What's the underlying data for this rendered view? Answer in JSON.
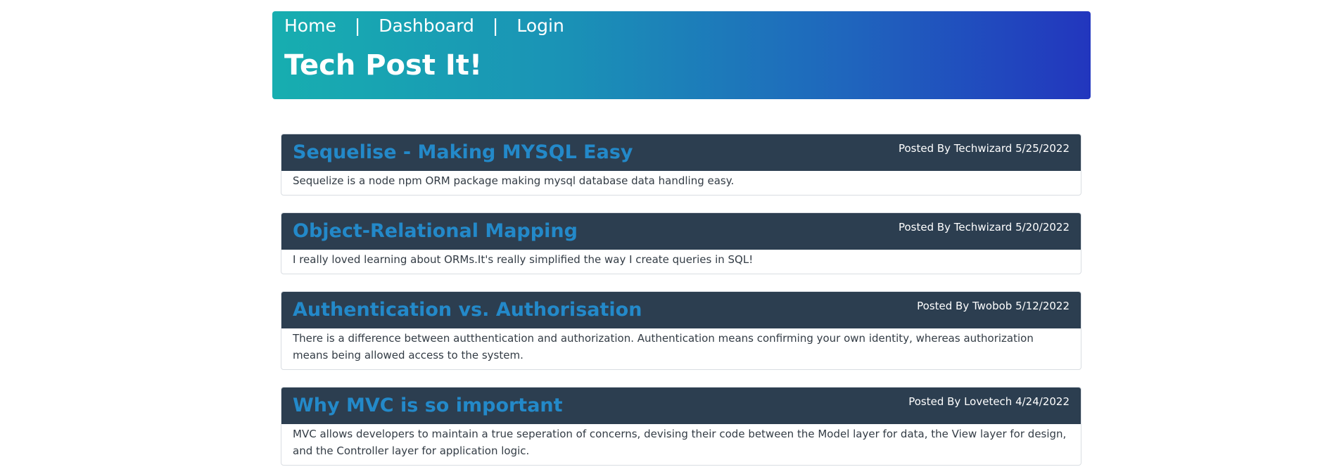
{
  "nav": {
    "home": "Home",
    "separator": "|",
    "dashboard": "Dashboard",
    "login": "Login"
  },
  "site": {
    "title": "Tech Post It!"
  },
  "colors": {
    "header_gradient_start": "#17aeb0",
    "header_gradient_end": "#2236be",
    "post_header_bg": "#2c3e50",
    "post_title": "#2389c9"
  },
  "posts": [
    {
      "title": "Sequelise - Making MYSQL Easy",
      "meta": "Posted By Techwizard 5/25/2022",
      "body": "Sequelize is a node npm ORM package making mysql database data handling easy."
    },
    {
      "title": "Object-Relational Mapping",
      "meta": "Posted By Techwizard 5/20/2022",
      "body": "I really loved learning about ORMs.It's really simplified the way I create queries in SQL!"
    },
    {
      "title": "Authentication vs. Authorisation",
      "meta": "Posted By Twobob 5/12/2022",
      "body": "There is a difference between autthentication and authorization. Authentication means confirming your own identity, whereas authorization means being allowed access to the system."
    },
    {
      "title": "Why MVC is so important",
      "meta": "Posted By Lovetech 4/24/2022",
      "body": "MVC allows developers to maintain a true seperation of concerns, devising their code between the Model layer for data, the View layer for design, and the Controller layer for application logic."
    }
  ]
}
